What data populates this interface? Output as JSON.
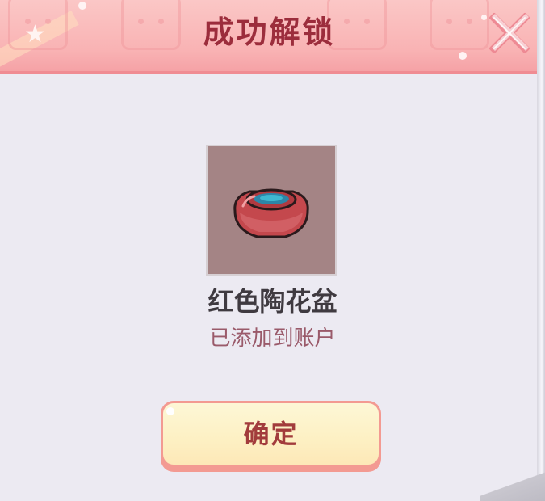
{
  "dialog": {
    "title": "成功解锁",
    "close_icon": "close-x-icon",
    "decor_icon": "star-icon"
  },
  "item": {
    "name": "红色陶花盆",
    "status": "已添加到账户",
    "icon": "red-clay-flowerpot-icon"
  },
  "actions": {
    "confirm_label": "确定"
  },
  "colors": {
    "header_bg": "#f9b3b4",
    "title_text": "#9c2d3c",
    "panel_bg": "#eceaf2",
    "item_frame_bg": "#a48485",
    "item_name_text": "#3f3a40",
    "status_text": "#9a5a6a",
    "button_fill": "#fdf0c3",
    "button_border": "#f39a92",
    "button_text": "#a23c3c"
  }
}
